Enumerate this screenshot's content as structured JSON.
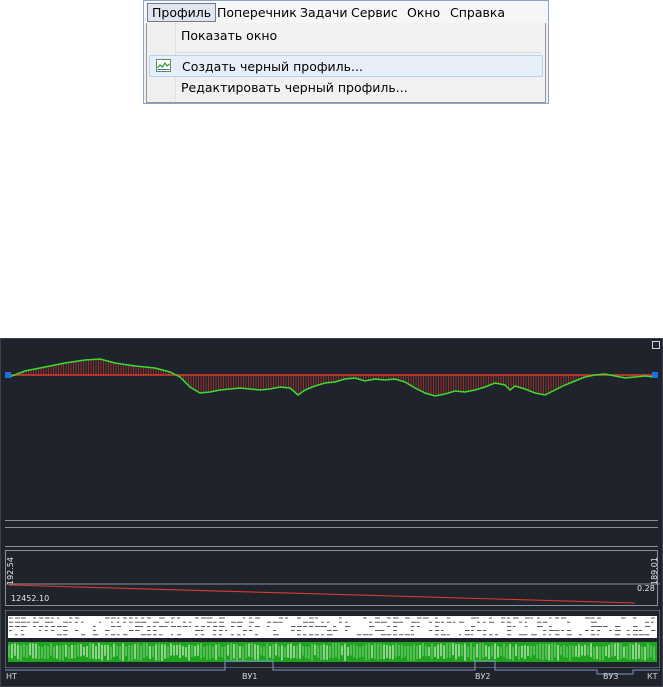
{
  "menubar": {
    "items": [
      "Профиль",
      "Поперечник",
      "Задачи",
      "Сервис",
      "Окно",
      "Справка"
    ],
    "active_index": 0
  },
  "dropdown": {
    "items": [
      {
        "label": "Показать окно",
        "icon": ""
      },
      {
        "label": "Создать черный профиль...",
        "icon": "profile-chart-icon",
        "highlighted": true
      },
      {
        "label": "Редактировать черный профиль...",
        "icon": ""
      }
    ]
  },
  "profile_view": {
    "colors": {
      "background": "#1f232b",
      "ground_line": "#3ddc2e",
      "design_line": "#e03a2a",
      "markers": "#1e6fe0"
    },
    "left_value": "192.54",
    "right_value": "189.01",
    "length_value": "12452.10",
    "slope_value": "0.28",
    "marks": [
      "НТ",
      "ВУ1",
      "ВУ2",
      "ВУ3",
      "КТ"
    ]
  }
}
